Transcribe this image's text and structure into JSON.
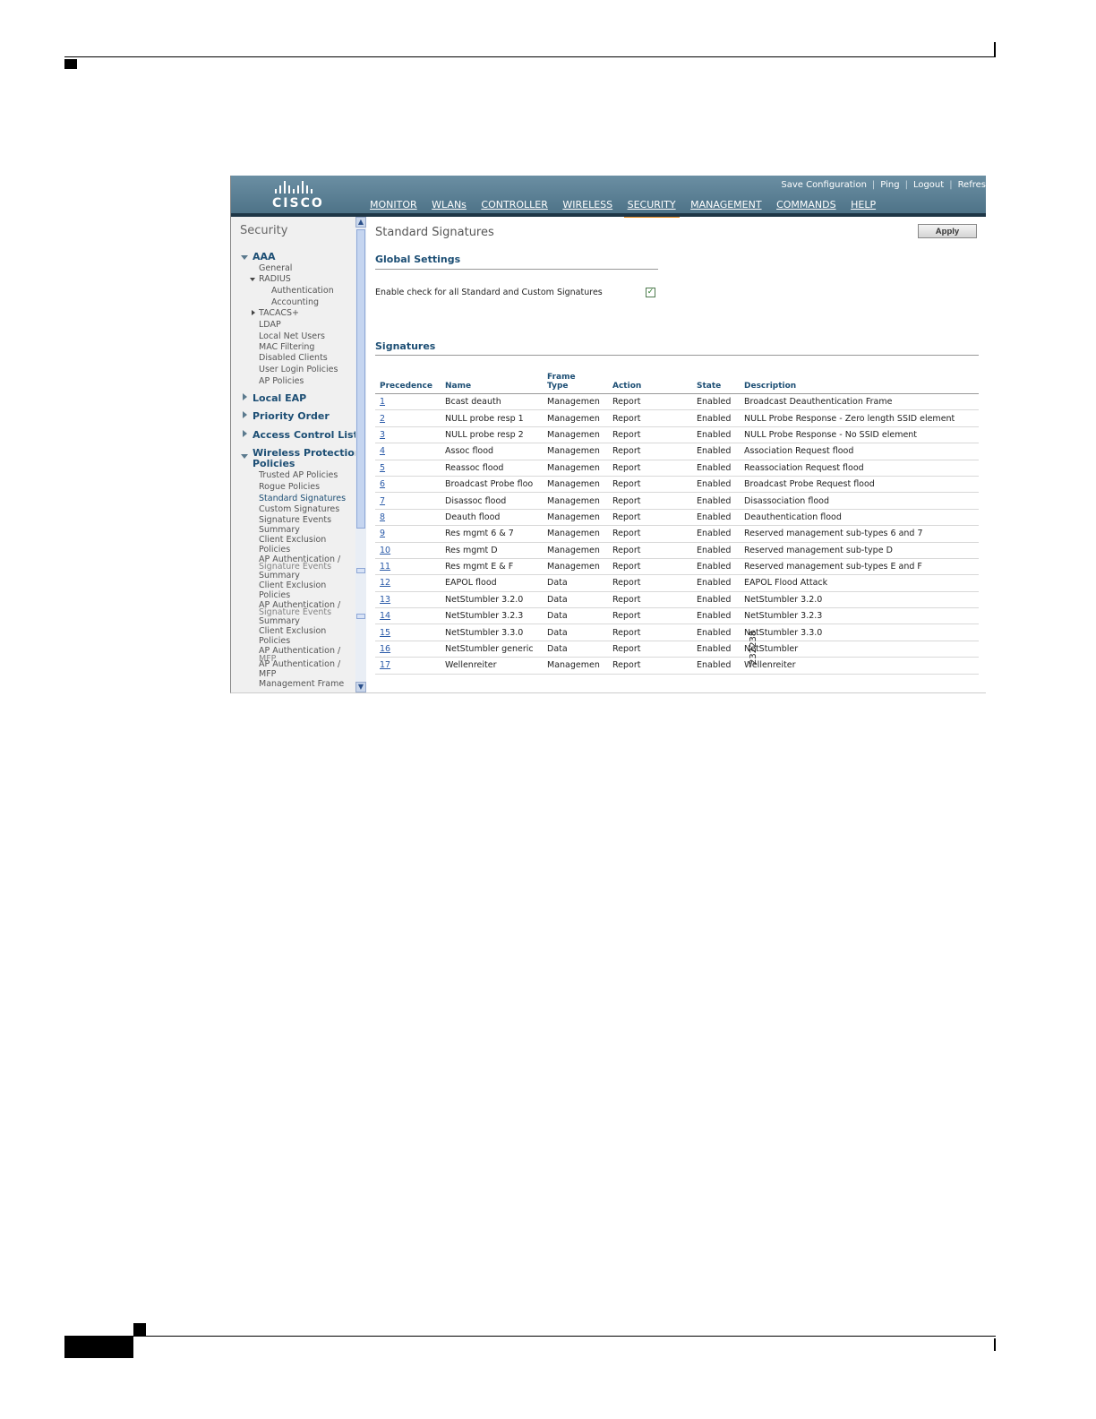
{
  "header": {
    "logo_text": "CISCO",
    "top_links": [
      "Save Configuration",
      "Ping",
      "Logout",
      "Refres"
    ],
    "nav": [
      {
        "label": "MONITOR",
        "active": false
      },
      {
        "label": "WLANs",
        "active": false
      },
      {
        "label": "CONTROLLER",
        "active": false
      },
      {
        "label": "WIRELESS",
        "active": false
      },
      {
        "label": "SECURITY",
        "active": true
      },
      {
        "label": "MANAGEMENT",
        "active": false
      },
      {
        "label": "COMMANDS",
        "active": false
      },
      {
        "label": "HELP",
        "active": false
      }
    ]
  },
  "sidebar": {
    "title": "Security",
    "aaa": {
      "label": "AAA",
      "items": [
        "General",
        "RADIUS",
        "Authentication",
        "Accounting",
        "TACACS+",
        "LDAP",
        "Local Net Users",
        "MAC Filtering",
        "Disabled Clients",
        "User Login Policies",
        "AP Policies"
      ]
    },
    "sections": [
      "Local EAP",
      "Priority Order",
      "Access Control Lists"
    ],
    "wpp": {
      "label_line1": "Wireless Protection",
      "label_line2": "Policies",
      "items": [
        "Trusted AP Policies",
        "Rogue Policies",
        "Standard Signatures",
        "Custom Signatures",
        "Signature Events",
        "Summary",
        "Client Exclusion",
        "Policies",
        "AP Authentication /",
        "Signature Events",
        "Summary",
        "Client Exclusion",
        "Policies",
        "AP Authentication /",
        "Signature Events",
        "Summary",
        "Client Exclusion",
        "Policies",
        "AP Authentication /",
        "MFP",
        "AP Authentication /",
        "MFP",
        "Management Frame"
      ]
    }
  },
  "main": {
    "title": "Standard Signatures",
    "apply_label": "Apply",
    "global_settings": "Global Settings",
    "setting_label": "Enable check for all Standard and Custom Signatures",
    "setting_checked": true,
    "signatures_title": "Signatures",
    "columns": [
      "Precedence",
      "Name",
      "Frame",
      "Type",
      "Action",
      "State",
      "Description"
    ],
    "rows": [
      [
        "1",
        "Bcast deauth",
        "Managemen",
        "Report",
        "Enabled",
        "Broadcast Deauthentication Frame"
      ],
      [
        "2",
        "NULL probe resp 1",
        "Managemen",
        "Report",
        "Enabled",
        "NULL Probe Response - Zero length SSID element"
      ],
      [
        "3",
        "NULL probe resp 2",
        "Managemen",
        "Report",
        "Enabled",
        "NULL Probe Response - No SSID element"
      ],
      [
        "4",
        "Assoc flood",
        "Managemen",
        "Report",
        "Enabled",
        "Association Request flood"
      ],
      [
        "5",
        "Reassoc flood",
        "Managemen",
        "Report",
        "Enabled",
        "Reassociation Request flood"
      ],
      [
        "6",
        "Broadcast Probe floo",
        "Managemen",
        "Report",
        "Enabled",
        "Broadcast Probe Request flood"
      ],
      [
        "7",
        "Disassoc flood",
        "Managemen",
        "Report",
        "Enabled",
        "Disassociation flood"
      ],
      [
        "8",
        "Deauth flood",
        "Managemen",
        "Report",
        "Enabled",
        "Deauthentication flood"
      ],
      [
        "9",
        "Res mgmt 6 & 7",
        "Managemen",
        "Report",
        "Enabled",
        "Reserved management sub-types 6 and 7"
      ],
      [
        "10",
        "Res mgmt D",
        "Managemen",
        "Report",
        "Enabled",
        "Reserved management sub-type D"
      ],
      [
        "11",
        "Res mgmt E & F",
        "Managemen",
        "Report",
        "Enabled",
        "Reserved management sub-types E and F"
      ],
      [
        "12",
        "EAPOL flood",
        "Data",
        "Report",
        "Enabled",
        "EAPOL Flood Attack"
      ],
      [
        "13",
        "NetStumbler 3.2.0",
        "Data",
        "Report",
        "Enabled",
        "NetStumbler 3.2.0"
      ],
      [
        "14",
        "NetStumbler 3.2.3",
        "Data",
        "Report",
        "Enabled",
        "NetStumbler 3.2.3"
      ],
      [
        "15",
        "NetStumbler 3.3.0",
        "Data",
        "Report",
        "Enabled",
        "NetStumbler 3.3.0"
      ],
      [
        "16",
        "NetStumbler generic",
        "Data",
        "Report",
        "Enabled",
        "NetStumbler"
      ],
      [
        "17",
        "Wellenreiter",
        "Managemen",
        "Report",
        "Enabled",
        "Wellenreiter"
      ]
    ]
  },
  "figure_number": "232238",
  "colors": {
    "header_blue": "#5a7f94",
    "active_tab_underline": "#e58a1f",
    "section_title": "#1c4e74",
    "link": "#2a5aa8"
  }
}
